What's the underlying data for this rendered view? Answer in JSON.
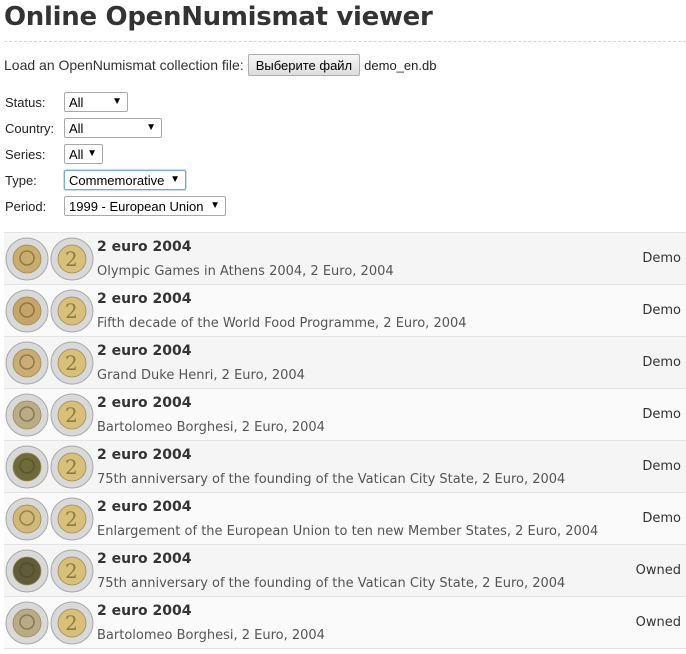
{
  "page": {
    "title": "Online OpenNumismat viewer"
  },
  "file": {
    "label": "Load an OpenNumismat collection file:",
    "button_label": "Выберите файл",
    "file_name": "demo_en.db"
  },
  "filters": {
    "status": {
      "label": "Status:",
      "value": "All"
    },
    "country": {
      "label": "Country:",
      "value": "All"
    },
    "series": {
      "label": "Series:",
      "value": "All"
    },
    "type": {
      "label": "Type:",
      "value": "Commemorative"
    },
    "period": {
      "label": "Period:",
      "value": "1999 - European Union"
    }
  },
  "coins": [
    {
      "title": "2 euro 2004",
      "description": "Olympic Games in Athens 2004, 2 Euro, 2004",
      "status": "Demo",
      "center_color": "#c9ad6e"
    },
    {
      "title": "2 euro 2004",
      "description": "Fifth decade of the World Food Programme, 2 Euro, 2004",
      "status": "Demo",
      "center_color": "#c7a56a"
    },
    {
      "title": "2 euro 2004",
      "description": "Grand Duke Henri, 2 Euro, 2004",
      "status": "Demo",
      "center_color": "#c9ad74"
    },
    {
      "title": "2 euro 2004",
      "description": "Bartolomeo Borghesi, 2 Euro, 2004",
      "status": "Demo",
      "center_color": "#b9ac86"
    },
    {
      "title": "2 euro 2004",
      "description": "75th anniversary of the founding of the Vatican City State, 2 Euro, 2004",
      "status": "Demo",
      "center_color": "#6d6a3c"
    },
    {
      "title": "2 euro 2004",
      "description": "Enlargement of the European Union to ten new Member States, 2 Euro, 2004",
      "status": "Demo",
      "center_color": "#d1b979"
    },
    {
      "title": "2 euro 2004",
      "description": "75th anniversary of the founding of the Vatican City State, 2 Euro, 2004",
      "status": "Owned",
      "center_color": "#5e5c3a"
    },
    {
      "title": "2 euro 2004",
      "description": "Bartolomeo Borghesi, 2 Euro, 2004",
      "status": "Owned",
      "center_color": "#b7ab88"
    }
  ],
  "colors": {
    "ring": "#d9d9d9",
    "coin_gold": "#d8bf7a",
    "row_border": "#e2e2e2"
  }
}
